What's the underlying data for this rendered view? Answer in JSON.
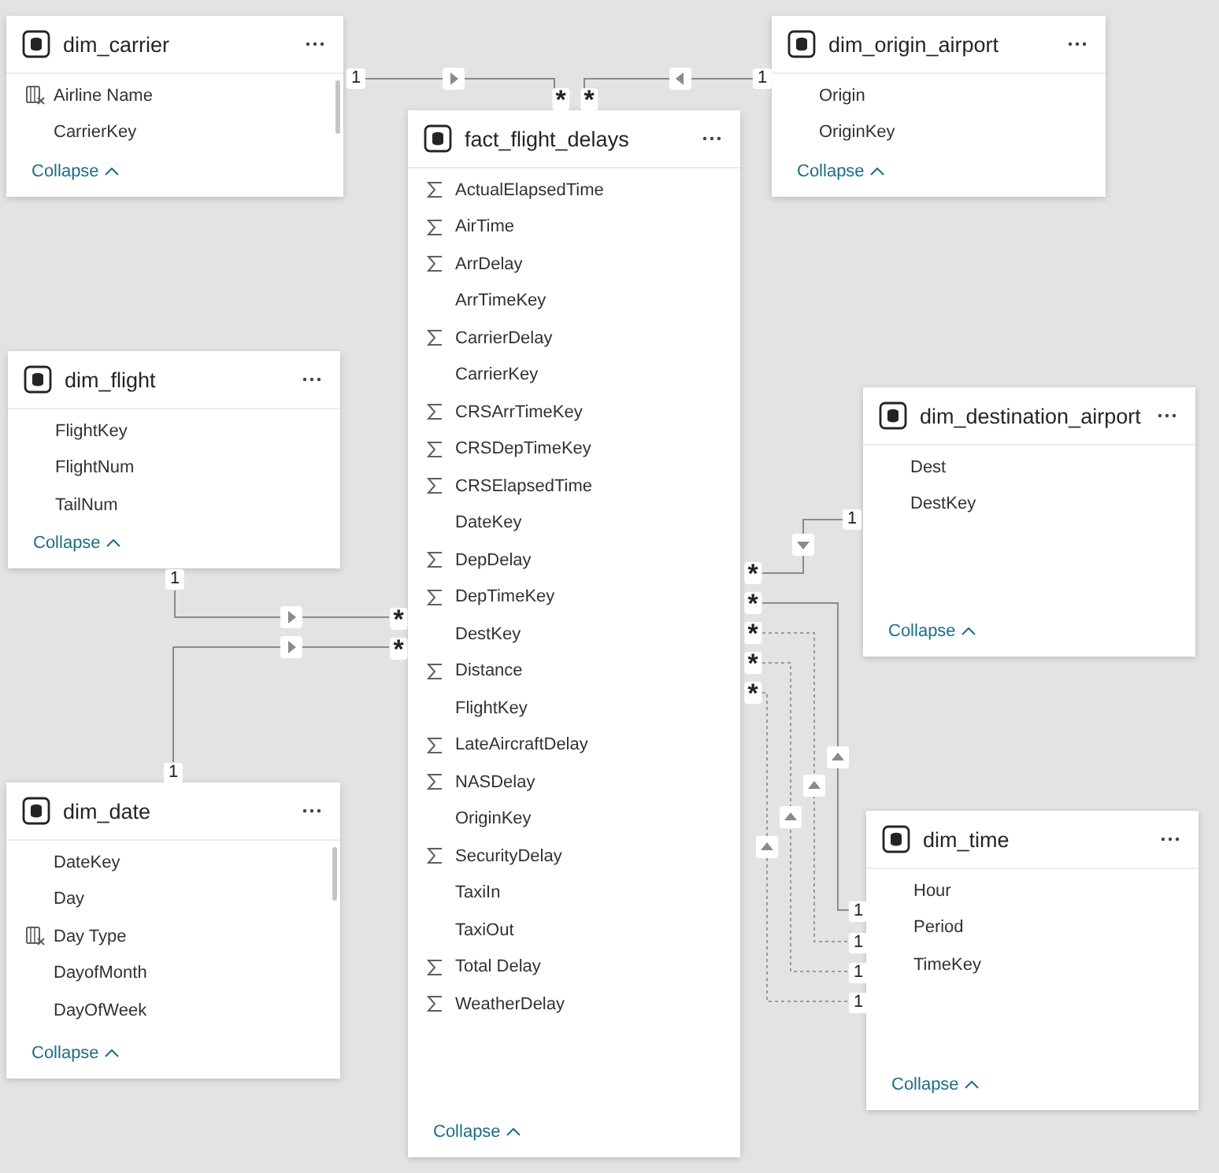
{
  "tables": [
    {
      "name": "dim_carrier",
      "collapse": "Collapse",
      "fields": [
        {
          "name": "Airline Name",
          "kind": "calculated"
        },
        {
          "name": "CarrierKey",
          "kind": "column"
        }
      ]
    },
    {
      "name": "dim_origin_airport",
      "collapse": "Collapse",
      "fields": [
        {
          "name": "Origin",
          "kind": "column"
        },
        {
          "name": "OriginKey",
          "kind": "column"
        }
      ]
    },
    {
      "name": "fact_flight_delays",
      "collapse": "Collapse",
      "fields": [
        {
          "name": "ActualElapsedTime",
          "kind": "measure"
        },
        {
          "name": "AirTime",
          "kind": "measure"
        },
        {
          "name": "ArrDelay",
          "kind": "measure"
        },
        {
          "name": "ArrTimeKey",
          "kind": "column"
        },
        {
          "name": "CarrierDelay",
          "kind": "measure"
        },
        {
          "name": "CarrierKey",
          "kind": "column"
        },
        {
          "name": "CRSArrTimeKey",
          "kind": "measure"
        },
        {
          "name": "CRSDepTimeKey",
          "kind": "measure"
        },
        {
          "name": "CRSElapsedTime",
          "kind": "measure"
        },
        {
          "name": "DateKey",
          "kind": "column"
        },
        {
          "name": "DepDelay",
          "kind": "measure"
        },
        {
          "name": "DepTimeKey",
          "kind": "measure"
        },
        {
          "name": "DestKey",
          "kind": "column"
        },
        {
          "name": "Distance",
          "kind": "measure"
        },
        {
          "name": "FlightKey",
          "kind": "column"
        },
        {
          "name": "LateAircraftDelay",
          "kind": "measure"
        },
        {
          "name": "NASDelay",
          "kind": "measure"
        },
        {
          "name": "OriginKey",
          "kind": "column"
        },
        {
          "name": "SecurityDelay",
          "kind": "measure"
        },
        {
          "name": "TaxiIn",
          "kind": "column"
        },
        {
          "name": "TaxiOut",
          "kind": "column"
        },
        {
          "name": "Total Delay",
          "kind": "measure"
        },
        {
          "name": "WeatherDelay",
          "kind": "measure"
        }
      ]
    },
    {
      "name": "dim_flight",
      "collapse": "Collapse",
      "fields": [
        {
          "name": "FlightKey",
          "kind": "column"
        },
        {
          "name": "FlightNum",
          "kind": "column"
        },
        {
          "name": "TailNum",
          "kind": "column"
        }
      ]
    },
    {
      "name": "dim_destination_airport",
      "collapse": "Collapse",
      "fields": [
        {
          "name": "Dest",
          "kind": "column"
        },
        {
          "name": "DestKey",
          "kind": "column"
        }
      ]
    },
    {
      "name": "dim_date",
      "collapse": "Collapse",
      "fields": [
        {
          "name": "DateKey",
          "kind": "column"
        },
        {
          "name": "Day",
          "kind": "column"
        },
        {
          "name": "Day Type",
          "kind": "calculated"
        },
        {
          "name": "DayofMonth",
          "kind": "column"
        },
        {
          "name": "DayOfWeek",
          "kind": "column"
        }
      ]
    },
    {
      "name": "dim_time",
      "collapse": "Collapse",
      "fields": [
        {
          "name": "Hour",
          "kind": "column"
        },
        {
          "name": "Period",
          "kind": "column"
        },
        {
          "name": "TimeKey",
          "kind": "column"
        }
      ]
    }
  ],
  "relationships": [
    {
      "one": "1",
      "many": "*",
      "active": true
    },
    {
      "one": "1",
      "many": "*",
      "active": true
    },
    {
      "one": "1",
      "many": "*",
      "active": true
    },
    {
      "one": "1",
      "many": "*",
      "active": true
    },
    {
      "one": "1",
      "many": "*",
      "active": true
    },
    {
      "one": "1",
      "many": "*",
      "active": true
    },
    {
      "one": "1",
      "many": "*",
      "active": false
    },
    {
      "one": "1",
      "many": "*",
      "active": false
    },
    {
      "one": "1",
      "many": "*",
      "active": false
    }
  ]
}
